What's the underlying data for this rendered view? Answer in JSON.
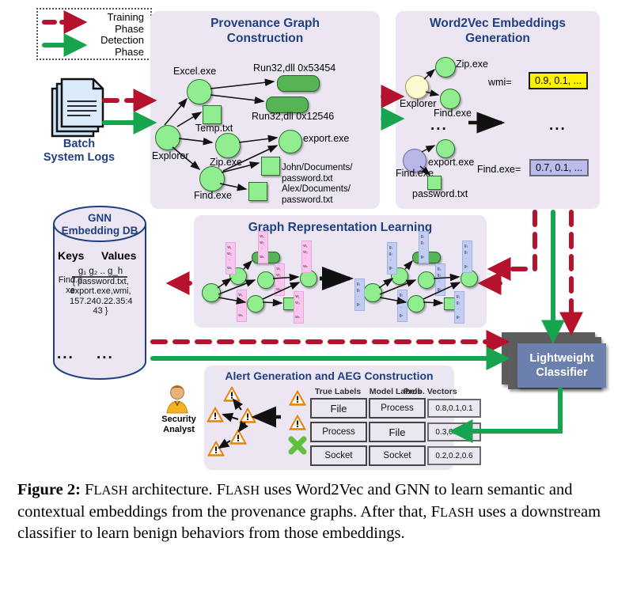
{
  "legend": {
    "training": "Training\nPhase",
    "detection": "Detection\nPhase",
    "training_label": "Training Phase",
    "detection_label": "Detection Phase",
    "t1": "Training",
    "t2": "Phase",
    "d1": "Detection",
    "d2": "Phase"
  },
  "source": {
    "label1": "Batch",
    "label2": "System Logs"
  },
  "panels": {
    "pgc": {
      "title1": "Provenance Graph",
      "title2": "Construction"
    },
    "w2v": {
      "title1": "Word2Vec Embeddings",
      "title2": "Generation"
    },
    "grl": {
      "title": "Graph Representation Learning"
    },
    "aeg": {
      "title": "Alert Generation and AEG Construction"
    }
  },
  "pgc_nodes": {
    "explorer": "Explorer",
    "excel": "Excel.exe",
    "temp": "Temp.txt",
    "zip": "Zip.exe",
    "find": "Find.exe",
    "export": "export.exe",
    "run_a": "Run32,dll 0x53454",
    "run_b": "Run32,dll 0x12546",
    "path_a1": "John/Documents/",
    "path_a2": "password.txt",
    "path_b1": "Alex/Documents/",
    "path_b2": "password.txt"
  },
  "w2v": {
    "explorer": "Explorer",
    "zip": "Zip.exe",
    "find_top": "Find.exe",
    "find_bot": "Find.exe",
    "export": "export.exe",
    "password": "password.txt",
    "ellipsis_left": "...",
    "ellipsis_right": "...",
    "key1": "wmi=",
    "val1": "0.9, 0.1, ...",
    "key2": "Find.exe=",
    "val2": "0.7, 0.1, ...",
    "color_yellow": "#fff300",
    "color_blue": "#bcbcec"
  },
  "grl": {
    "vector_left": "w₁ w₂ .. w_n",
    "vector_right": "g₁ g₂ .. g_h",
    "v_left_lines": [
      "w₁",
      "w₂",
      ".",
      "w_n"
    ],
    "v_right_lines": [
      "g₁",
      "g₂",
      ".",
      "g_h"
    ],
    "color_left": "#fbc5ef",
    "color_right": "#c2cdf4"
  },
  "db": {
    "title1": "GNN",
    "title2": "Embedding DB",
    "col_keys": "Keys",
    "col_values": "Values",
    "key_row1a": "Find.e",
    "key_row1b": "xe",
    "value_row1_top": "g₁ g₂ .. g_h",
    "value_row1_set1": "{ password.txt,",
    "value_row1_set2": "export.exe,wmi,",
    "value_row1_set3": "157.240.22.35:4",
    "value_row1_set4": "43 }",
    "key_more": "...",
    "value_more": "..."
  },
  "classifier": {
    "line1": "Lightweight",
    "line2": "Classifier",
    "color": "#6b80ad"
  },
  "aeg": {
    "analyst1": "Security",
    "analyst2": "Analyst",
    "headers": [
      "True Labels",
      "Model Labels",
      "Prob. Vectors"
    ],
    "rows": [
      {
        "true": "File",
        "model": "Process",
        "prob": "0.8,0.1,0.1",
        "mark": "alert"
      },
      {
        "true": "Process",
        "model": "File",
        "prob": "0.3,0.5,0.2",
        "mark": "alert"
      },
      {
        "true": "Socket",
        "model": "Socket",
        "prob": "0.2,0.2,0.6",
        "mark": "cross"
      }
    ]
  },
  "caption": {
    "prefix": "Figure 2:",
    "text": " FLASH architecture. FLASH uses Word2Vec and GNN to learn semantic and contextual embeddings from the provenance graphs. After that, FLASH uses a downstream classifier to learn benign behaviors from those embeddings."
  },
  "colors": {
    "training_red": "#b5122e",
    "detection_green": "#17a44f",
    "title_blue": "#1f3f80",
    "panel_bg": "#ece6f2"
  }
}
